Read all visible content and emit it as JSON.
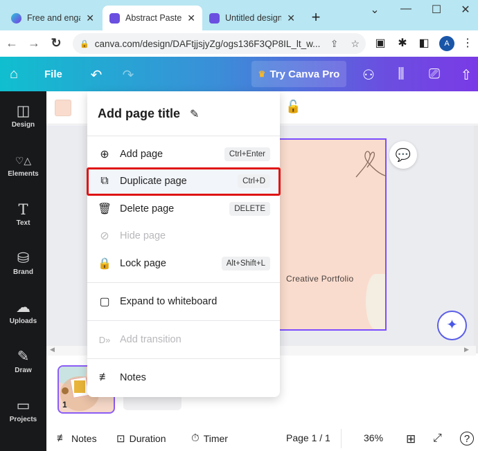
{
  "browser": {
    "tabs": [
      {
        "title": "Free and engaging",
        "favicon": "canva-logo-icon",
        "active": false
      },
      {
        "title": "Abstract Pastel",
        "favicon": "canva-design-icon",
        "active": true
      },
      {
        "title": "Untitled design",
        "favicon": "canva-design-icon",
        "active": false
      }
    ],
    "new_tab": "+",
    "window_controls": {
      "dropdown": "⌄",
      "minimize": "—",
      "maximize": "☐",
      "close": "✕"
    },
    "url": "canva.com/design/DAFtjjsjyZg/ogs136F3QP8IL_lt_w...",
    "avatar_letter": "A"
  },
  "header": {
    "file_label": "File",
    "try_pro_label": "Try Canva Pro",
    "colors": {
      "gradient_start": "#10bfcf",
      "gradient_end": "#7a3ae6"
    }
  },
  "sidebar": {
    "items": [
      {
        "label": "Design",
        "icon": "design-icon",
        "glyph": "◫"
      },
      {
        "label": "Elements",
        "icon": "elements-icon",
        "glyph": "♡△"
      },
      {
        "label": "Text",
        "icon": "text-icon",
        "glyph": "T"
      },
      {
        "label": "Brand",
        "icon": "brand-icon",
        "glyph": "⛁"
      },
      {
        "label": "Uploads",
        "icon": "uploads-icon",
        "glyph": "☁"
      },
      {
        "label": "Draw",
        "icon": "draw-icon",
        "glyph": "✎"
      },
      {
        "label": "Projects",
        "icon": "projects-icon",
        "glyph": "▭"
      }
    ]
  },
  "canvas": {
    "page_text": "Creative Portfolio",
    "page_color": "#f9dccd",
    "selection_color": "#7c4dff"
  },
  "menu": {
    "title": "Add page title",
    "items": [
      {
        "label": "Add page",
        "shortcut": "Ctrl+Enter",
        "icon": "add-page-icon",
        "glyph": "⊕",
        "disabled": false
      },
      {
        "label": "Duplicate page",
        "shortcut": "Ctrl+D",
        "icon": "duplicate-page-icon",
        "glyph": "⧉",
        "disabled": false,
        "highlighted": true
      },
      {
        "label": "Delete page",
        "shortcut": "DELETE",
        "icon": "trash-icon",
        "glyph": "🗑",
        "disabled": false
      },
      {
        "label": "Hide page",
        "shortcut": "",
        "icon": "eye-off-icon",
        "glyph": "⊘",
        "disabled": true
      },
      {
        "label": "Lock page",
        "shortcut": "Alt+Shift+L",
        "icon": "lock-icon",
        "glyph": "🔒",
        "disabled": false
      },
      {
        "label": "Expand to whiteboard",
        "shortcut": "",
        "icon": "expand-whiteboard-icon",
        "glyph": "▢",
        "disabled": false
      },
      {
        "label": "Add transition",
        "shortcut": "",
        "icon": "transition-icon",
        "glyph": "D»",
        "disabled": true
      },
      {
        "label": "Notes",
        "shortcut": "",
        "icon": "notes-icon",
        "glyph": "≢",
        "disabled": false
      }
    ],
    "highlight_color": "#e01313"
  },
  "pages": {
    "thumbnail_number": "1"
  },
  "footer": {
    "notes_label": "Notes",
    "duration_label": "Duration",
    "timer_label": "Timer",
    "page_indicator": "Page 1 / 1",
    "zoom": "36%"
  }
}
